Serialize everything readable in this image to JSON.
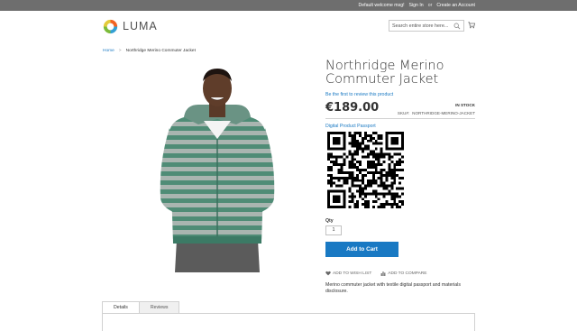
{
  "header": {
    "welcome": "Default welcome msg!",
    "sign_in": "Sign In",
    "or": "or",
    "create_account": "Create an Account",
    "logo_text": "LUMA",
    "logo_colors": [
      "#f26322",
      "#e3cb3a",
      "#33a0d4",
      "#7cbb3a"
    ],
    "search_placeholder": "Search entire store here..."
  },
  "breadcrumb": {
    "home": "Home",
    "separator": ">",
    "current": "Northridge Merino Commuter Jacket"
  },
  "product": {
    "name": "Northridge Merino Commuter Jacket",
    "review_link": "Be the first to review this product",
    "price": "€189.00",
    "stock": "In stock",
    "sku_label": "SKU#:",
    "sku": "NORTHRIDGE-MERINO-JACKET",
    "dpp_label": "Digital Product Passport",
    "qty_label": "Qty",
    "qty_value": "1",
    "add_to_cart": "Add to Cart",
    "wish_list": "Add to Wish List",
    "compare": "Add to Compare",
    "description": "Merino commuter jacket with textile digital passport and materials disclosure."
  },
  "tabs": [
    {
      "label": "Details",
      "active": true
    },
    {
      "label": "Reviews",
      "active": false
    }
  ],
  "colors": {
    "accent": "#1979c3",
    "topbar": "#6e6e6e"
  }
}
